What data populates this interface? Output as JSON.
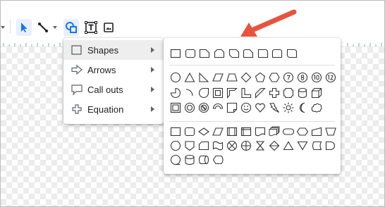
{
  "toolbar": {
    "tools": [
      "select-tool",
      "line-tool",
      "line-dropdown",
      "shape-tool",
      "textbox-tool",
      "image-tool"
    ]
  },
  "insert_menu": {
    "items": [
      {
        "label": "Shapes",
        "icon": "square-icon",
        "active": true
      },
      {
        "label": "Arrows",
        "icon": "arrow-right-icon",
        "active": false
      },
      {
        "label": "Call outs",
        "icon": "callout-icon",
        "active": false
      },
      {
        "label": "Equation",
        "icon": "plus-icon",
        "active": false
      }
    ]
  },
  "shapes_panel": {
    "groups": [
      "shapes",
      "basic-shapes",
      "flowchart"
    ]
  },
  "colors": {
    "accent": "#1a73e8",
    "annotation_arrow": "#e8533f",
    "selected_bg": "#e8f0fe"
  }
}
